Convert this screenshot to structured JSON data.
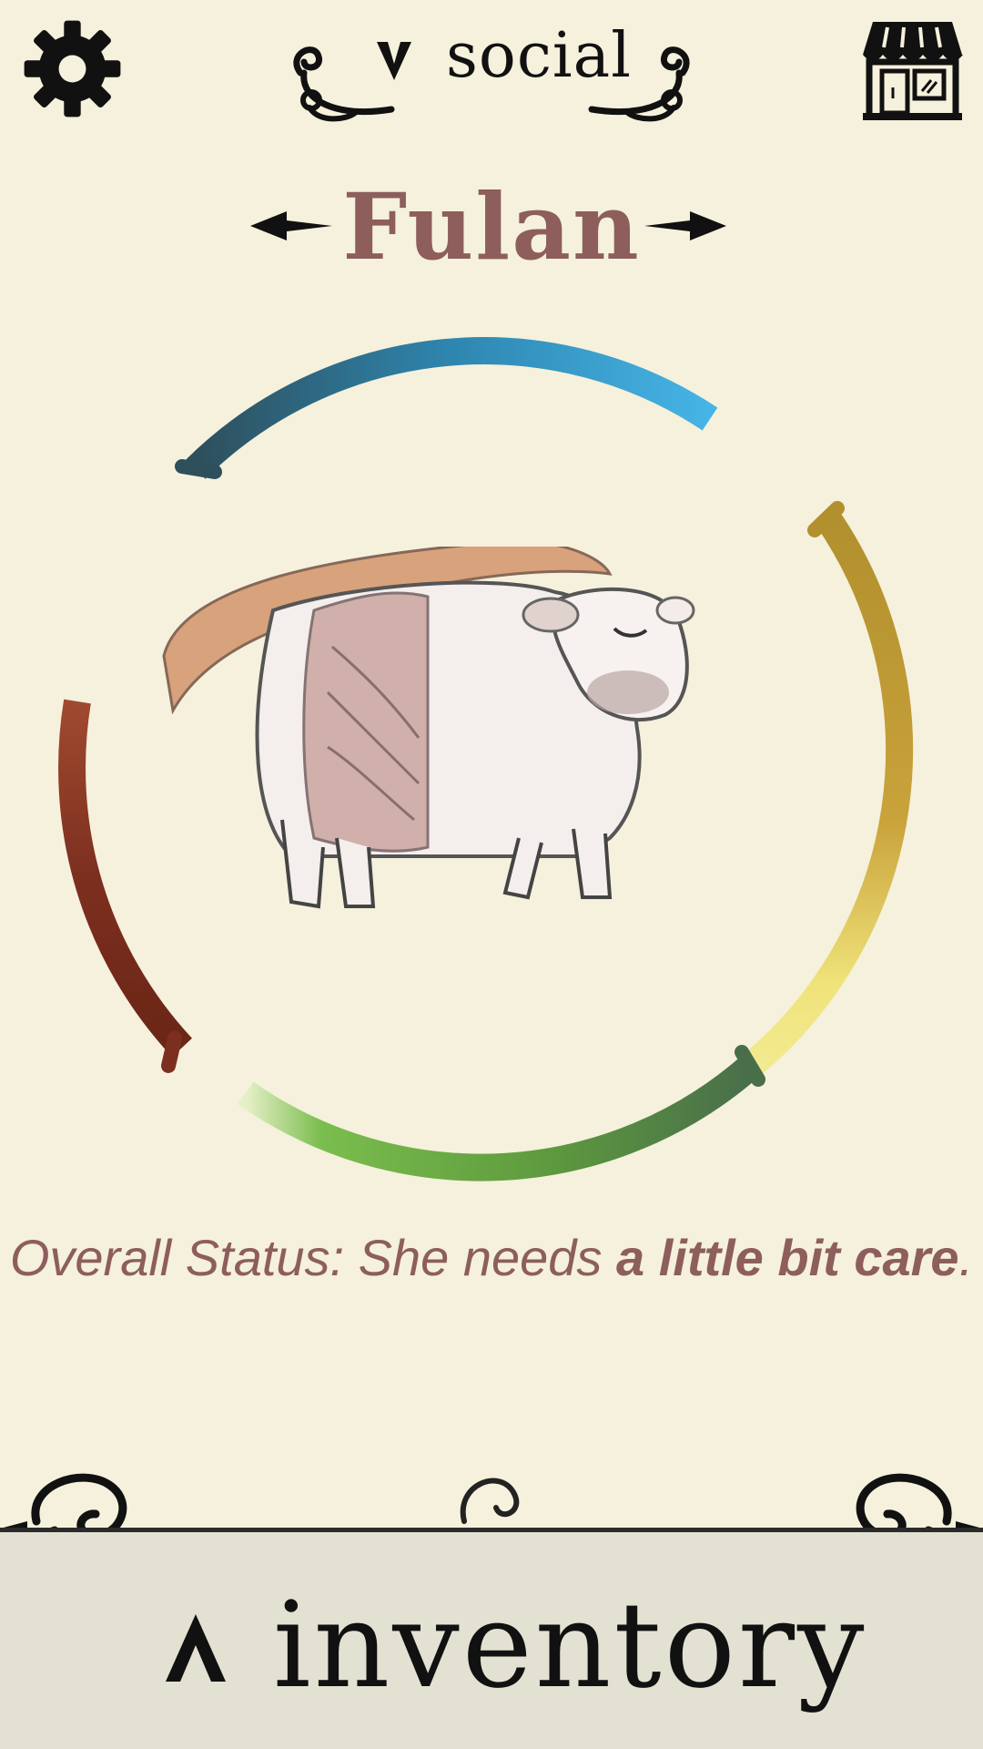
{
  "header": {
    "section_label": "social",
    "settings_icon": "gear-icon",
    "shop_icon": "shop-storefront-icon",
    "section_toggle_icon": "chevron-down-icon"
  },
  "pet": {
    "name": "Fulan",
    "prev_icon": "diamond-arrow-left-icon",
    "next_icon": "diamond-arrow-right-icon",
    "illustration": "cow-sketch"
  },
  "status": {
    "prefix": "Overall Status: She needs ",
    "emphasis": "a little bit care",
    "suffix": "."
  },
  "stats": [
    {
      "name": "blue-stat",
      "color": "#3aa8dc",
      "level": 0.65
    },
    {
      "name": "gold-stat",
      "color": "#c9a43c",
      "level": 0.75
    },
    {
      "name": "green-stat",
      "color": "#6db04a",
      "level": 0.8
    },
    {
      "name": "red-stat",
      "color": "#7d2f1f",
      "level": 0.6
    }
  ],
  "footer": {
    "tab_label": "inventory",
    "toggle_icon": "chevron-up-icon"
  },
  "colors": {
    "background": "#f5f1dc",
    "accent": "#8d5e5c",
    "footer_bg": "#e3e1d2"
  }
}
